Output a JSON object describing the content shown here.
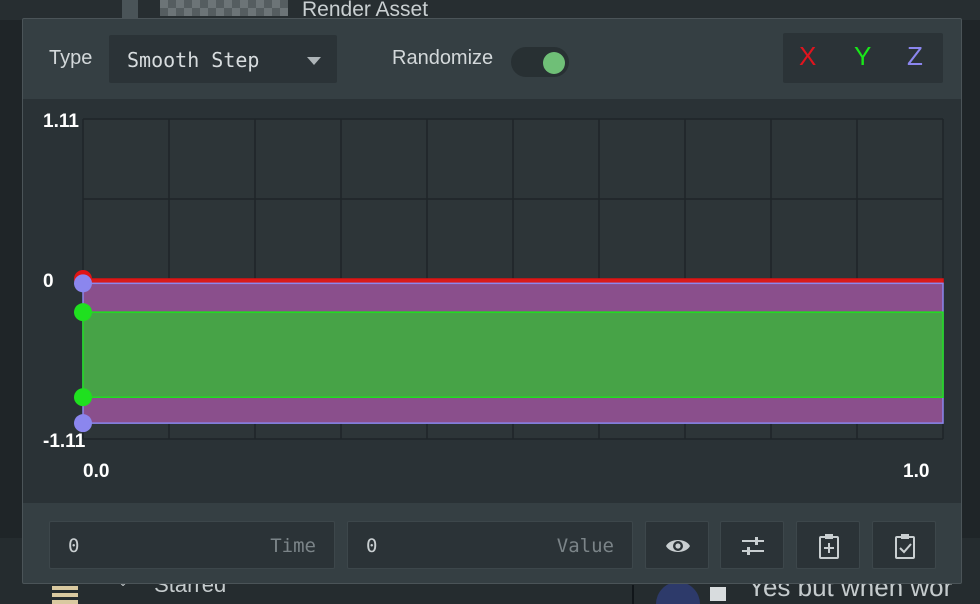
{
  "background": {
    "panel_title": "Render Asset",
    "section_label": "Starred",
    "message_preview": "Yes but when wor"
  },
  "toolbar": {
    "type_label": "Type",
    "type_value": "Smooth Step",
    "randomize_label": "Randomize",
    "randomize_on": true,
    "axis_buttons": [
      {
        "label": "X",
        "color": "#e0141e"
      },
      {
        "label": "Y",
        "color": "#19e619"
      },
      {
        "label": "Z",
        "color": "#8b86ee"
      }
    ]
  },
  "chart_data": {
    "type": "area",
    "ylim": [
      -1.11,
      1.11
    ],
    "xlim": [
      0.0,
      1.0
    ],
    "y_tick_labels": [
      "1.11",
      "0",
      "-1.11"
    ],
    "x_tick_labels": [
      "0.0",
      "1.0"
    ],
    "grid": true,
    "grid_columns": 10,
    "grid_rows": 4,
    "series": [
      {
        "name": "X",
        "color": "#e01414",
        "fill": "#d81b1b",
        "min": -0.03,
        "max": 0.0
      },
      {
        "name": "Z",
        "color": "#8b86ee",
        "fill": "#8a4f8c",
        "min": -1.0,
        "max": -0.03
      },
      {
        "name": "Y",
        "color": "#1fe01f",
        "fill": "#47a347",
        "min": -0.82,
        "max": -0.23
      }
    ],
    "keyframes": [
      {
        "series": "X",
        "x": 0.0,
        "y": 0.0
      },
      {
        "series": "Z",
        "x": 0.0,
        "y": -0.03
      },
      {
        "series": "Y",
        "x": 0.0,
        "y": -0.23
      },
      {
        "series": "Y",
        "x": 0.0,
        "y": -0.82
      },
      {
        "series": "Z",
        "x": 0.0,
        "y": -1.0
      }
    ]
  },
  "bottom": {
    "time_value": "0",
    "time_label": "Time",
    "value_value": "0",
    "value_label": "Value",
    "buttons": [
      "eye-icon",
      "sliders-icon",
      "paste-add-icon",
      "paste-check-icon"
    ]
  }
}
